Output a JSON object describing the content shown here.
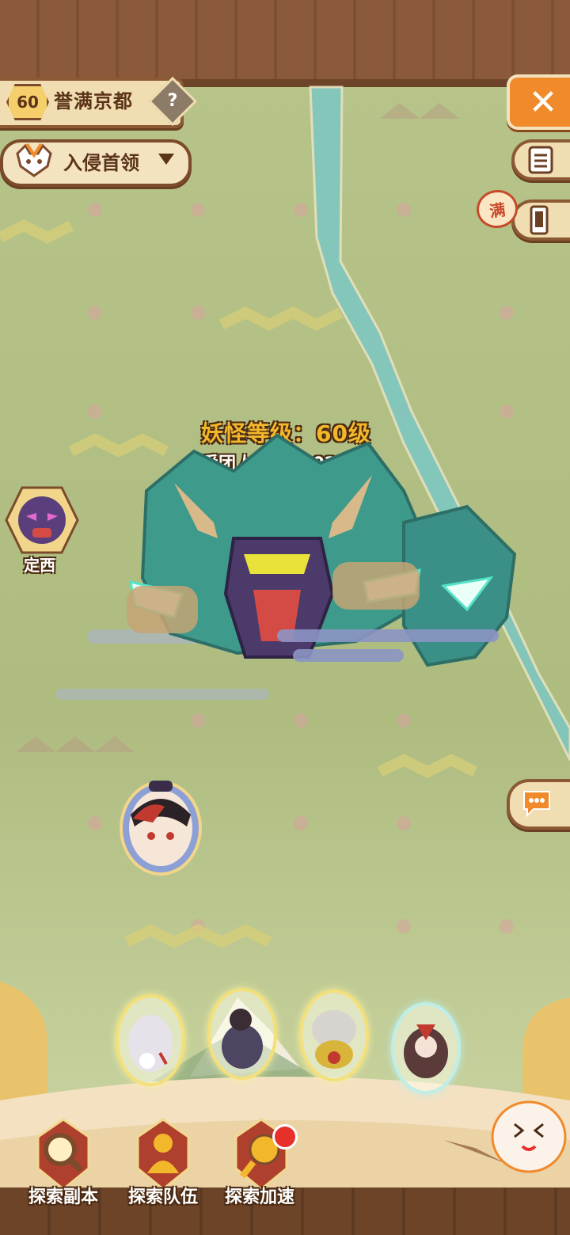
{
  "header": {
    "level": "60",
    "region_name": "誉满京都",
    "help_symbol": "?",
    "invade_label": "入侵首领",
    "close_symbol": "✕"
  },
  "side": {
    "full_tag": "满"
  },
  "boss": {
    "level_text": "妖怪等级：60级",
    "count_text": "受团人数：2302人"
  },
  "player": {
    "name": "定西"
  },
  "bottom": {
    "actions": [
      {
        "label": "探索副本",
        "icon": "magnifier-icon"
      },
      {
        "label": "探索队伍",
        "icon": "team-icon"
      },
      {
        "label": "探索加速",
        "icon": "accelerate-icon"
      }
    ],
    "team_slots": 4
  },
  "colors": {
    "accent_orange": "#f08a2a",
    "wood": "#8b5a34",
    "gold_text": "#f3b72b",
    "map_green": "#b6c389",
    "river": "#7fc7c0"
  }
}
